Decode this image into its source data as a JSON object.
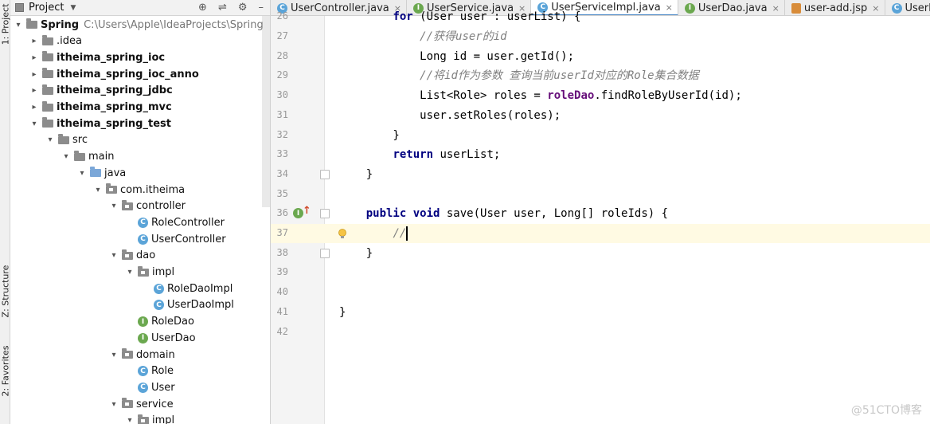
{
  "side_strip": {
    "project_label": "1: Project",
    "structure_label": "Z: Structure",
    "favorites_label": "2: Favorites"
  },
  "project_panel": {
    "title": "Project",
    "tool_icons": [
      "target-icon",
      "split-icon",
      "gear-icon",
      "hide-icon"
    ],
    "tree": [
      {
        "label": "Spring",
        "path": "C:\\Users\\Apple\\IdeaProjects\\Spring",
        "depth": 0,
        "arrow": "▾",
        "icon": "module",
        "bold": true
      },
      {
        "label": ".idea",
        "depth": 1,
        "arrow": "▸",
        "icon": "folder"
      },
      {
        "label": "itheima_spring_ioc",
        "depth": 1,
        "arrow": "▸",
        "icon": "module",
        "bold": true
      },
      {
        "label": "itheima_spring_ioc_anno",
        "depth": 1,
        "arrow": "▸",
        "icon": "module",
        "bold": true
      },
      {
        "label": "itheima_spring_jdbc",
        "depth": 1,
        "arrow": "▸",
        "icon": "module",
        "bold": true
      },
      {
        "label": "itheima_spring_mvc",
        "depth": 1,
        "arrow": "▸",
        "icon": "module",
        "bold": true
      },
      {
        "label": "itheima_spring_test",
        "depth": 1,
        "arrow": "▾",
        "icon": "module",
        "bold": true
      },
      {
        "label": "src",
        "depth": 2,
        "arrow": "▾",
        "icon": "folder"
      },
      {
        "label": "main",
        "depth": 3,
        "arrow": "▾",
        "icon": "folder"
      },
      {
        "label": "java",
        "depth": 4,
        "arrow": "▾",
        "icon": "source"
      },
      {
        "label": "com.itheima",
        "depth": 5,
        "arrow": "▾",
        "icon": "package"
      },
      {
        "label": "controller",
        "depth": 6,
        "arrow": "▾",
        "icon": "package"
      },
      {
        "label": "RoleController",
        "depth": 7,
        "arrow": "",
        "icon": "class"
      },
      {
        "label": "UserController",
        "depth": 7,
        "arrow": "",
        "icon": "class"
      },
      {
        "label": "dao",
        "depth": 6,
        "arrow": "▾",
        "icon": "package"
      },
      {
        "label": "impl",
        "depth": 7,
        "arrow": "▾",
        "icon": "package"
      },
      {
        "label": "RoleDaoImpl",
        "depth": 8,
        "arrow": "",
        "icon": "class"
      },
      {
        "label": "UserDaoImpl",
        "depth": 8,
        "arrow": "",
        "icon": "class"
      },
      {
        "label": "RoleDao",
        "depth": 7,
        "arrow": "",
        "icon": "interface"
      },
      {
        "label": "UserDao",
        "depth": 7,
        "arrow": "",
        "icon": "interface"
      },
      {
        "label": "domain",
        "depth": 6,
        "arrow": "▾",
        "icon": "package"
      },
      {
        "label": "Role",
        "depth": 7,
        "arrow": "",
        "icon": "class"
      },
      {
        "label": "User",
        "depth": 7,
        "arrow": "",
        "icon": "class"
      },
      {
        "label": "service",
        "depth": 6,
        "arrow": "▾",
        "icon": "package"
      },
      {
        "label": "impl",
        "depth": 7,
        "arrow": "▾",
        "icon": "package"
      }
    ]
  },
  "tabs": [
    {
      "label": "UserController.java",
      "icon": "class",
      "active": false
    },
    {
      "label": "UserService.java",
      "icon": "interface",
      "active": false
    },
    {
      "label": "UserServiceImpl.java",
      "icon": "class",
      "active": true
    },
    {
      "label": "UserDao.java",
      "icon": "interface",
      "active": false
    },
    {
      "label": "user-add.jsp",
      "icon": "jsp",
      "active": false
    },
    {
      "label": "UserDaoImpl.java",
      "icon": "class",
      "active": false
    }
  ],
  "editor": {
    "current_line": "37",
    "lines": [
      {
        "num": "26",
        "tokens": [
          {
            "t": "        "
          },
          {
            "t": "for",
            "c": "kw"
          },
          {
            "t": " (User user : userList) {"
          }
        ]
      },
      {
        "num": "27",
        "tokens": [
          {
            "t": "            "
          },
          {
            "t": "//获得user的id",
            "c": "cm"
          }
        ]
      },
      {
        "num": "28",
        "tokens": [
          {
            "t": "            Long id = user.getId();"
          }
        ]
      },
      {
        "num": "29",
        "tokens": [
          {
            "t": "            "
          },
          {
            "t": "//将id作为参数 查询当前userId对应的Role集合数据",
            "c": "cm"
          }
        ]
      },
      {
        "num": "30",
        "tokens": [
          {
            "t": "            List<Role> roles = "
          },
          {
            "t": "roleDao",
            "c": "fld"
          },
          {
            "t": ".findRoleByUserId(id);"
          }
        ]
      },
      {
        "num": "31",
        "tokens": [
          {
            "t": "            user.setRoles(roles);"
          }
        ]
      },
      {
        "num": "32",
        "tokens": [
          {
            "t": "        }"
          }
        ]
      },
      {
        "num": "33",
        "tokens": [
          {
            "t": "        "
          },
          {
            "t": "return",
            "c": "kw"
          },
          {
            "t": " userList;"
          }
        ]
      },
      {
        "num": "34",
        "tokens": [
          {
            "t": "    }"
          }
        ]
      },
      {
        "num": "35",
        "tokens": [
          {
            "t": ""
          }
        ]
      },
      {
        "num": "36",
        "tokens": [
          {
            "t": "    "
          },
          {
            "t": "public",
            "c": "kw"
          },
          {
            "t": " "
          },
          {
            "t": "void",
            "c": "kw"
          },
          {
            "t": " save(User user, Long[] roleIds) {"
          }
        ]
      },
      {
        "num": "37",
        "tokens": [
          {
            "t": "        "
          },
          {
            "t": "//",
            "c": "cm"
          }
        ]
      },
      {
        "num": "38",
        "tokens": [
          {
            "t": "    }"
          }
        ]
      },
      {
        "num": "39",
        "tokens": [
          {
            "t": ""
          }
        ]
      },
      {
        "num": "40",
        "tokens": [
          {
            "t": ""
          }
        ]
      },
      {
        "num": "41",
        "tokens": [
          {
            "t": "}"
          }
        ]
      },
      {
        "num": "42",
        "tokens": [
          {
            "t": ""
          }
        ]
      }
    ]
  },
  "watermark": "@51CTO博客"
}
